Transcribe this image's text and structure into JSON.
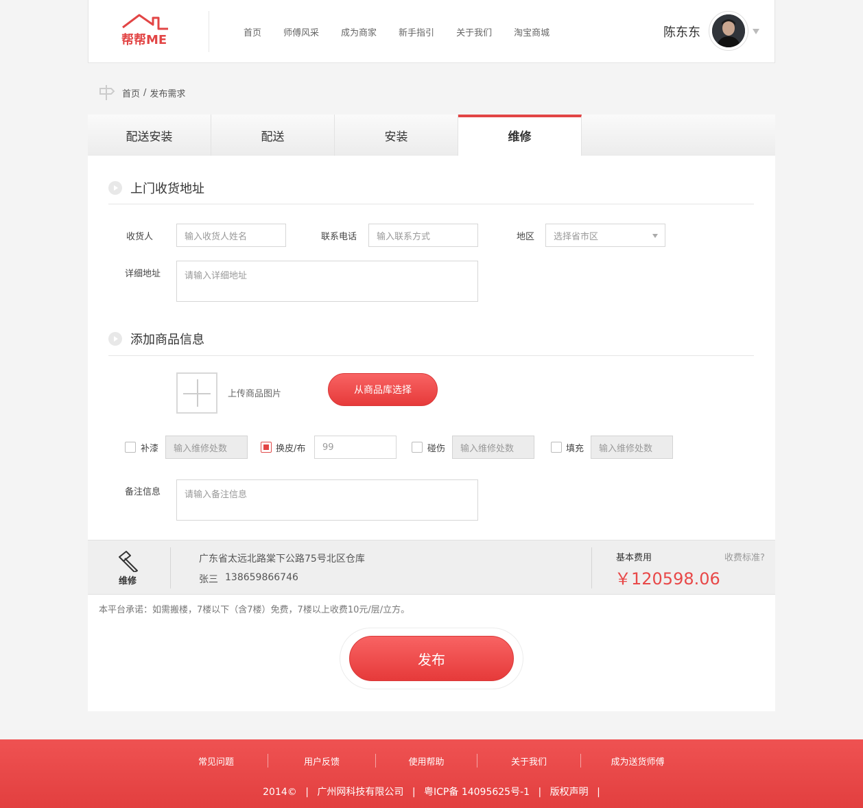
{
  "header": {
    "logo_text": "帮帮ME",
    "nav": [
      "首页",
      "师傅风采",
      "成为商家",
      "新手指引",
      "关于我们",
      "淘宝商城"
    ],
    "user_name": "陈东东"
  },
  "breadcrumb": {
    "home": "首页",
    "sep": "/",
    "current": "发布需求"
  },
  "tabs": [
    {
      "label": "配送安装",
      "active": false
    },
    {
      "label": "配送",
      "active": false
    },
    {
      "label": "安装",
      "active": false
    },
    {
      "label": "维修",
      "active": true
    }
  ],
  "address_section": {
    "title": "上门收货地址",
    "receiver_label": "收货人",
    "receiver_placeholder": "输入收货人姓名",
    "phone_label": "联系电话",
    "phone_placeholder": "输入联系方式",
    "region_label": "地区",
    "region_placeholder": "选择省市区",
    "detail_label": "详细地址",
    "detail_placeholder": "请输入详细地址"
  },
  "goods_section": {
    "title": "添加商品信息",
    "upload_label": "上传商品图片",
    "library_button": "从商品库选择",
    "repairs": [
      {
        "label": "补漆",
        "checked": false,
        "placeholder": "输入维修处数",
        "value": "",
        "disabled": true
      },
      {
        "label": "换皮/布",
        "checked": true,
        "placeholder": "输入维修处数",
        "value": "99",
        "disabled": false
      },
      {
        "label": "碰伤",
        "checked": false,
        "placeholder": "输入维修处数",
        "value": "",
        "disabled": true
      },
      {
        "label": "填充",
        "checked": false,
        "placeholder": "输入维修处数",
        "value": "",
        "disabled": true
      }
    ],
    "remark_label": "备注信息",
    "remark_placeholder": "请输入备注信息"
  },
  "summary": {
    "service_label": "维修",
    "address": "广东省太远北路棠下公路75号北区仓库",
    "contact_name": "张三",
    "contact_phone": "138659866746",
    "fee_label": "基本费用",
    "fee_standard_link": "收费标准?",
    "fee_amount": "￥120598.06"
  },
  "promise_note": "本平台承诺：如需搬楼，7楼以下（含7楼）免费，7楼以上收费10元/层/立方。",
  "publish_button": "发布",
  "footer": {
    "links": [
      "常见问题",
      "用户反馈",
      "使用帮助",
      "关于我们",
      "成为送货师傅"
    ],
    "copyright": [
      "2014©",
      "|",
      "广州网科技有限公司",
      "|",
      "粤ICP备 14095625号-1",
      "|",
      "版权声明",
      "|"
    ]
  },
  "colors": {
    "accent": "#e24545",
    "footer": "#e84848"
  }
}
